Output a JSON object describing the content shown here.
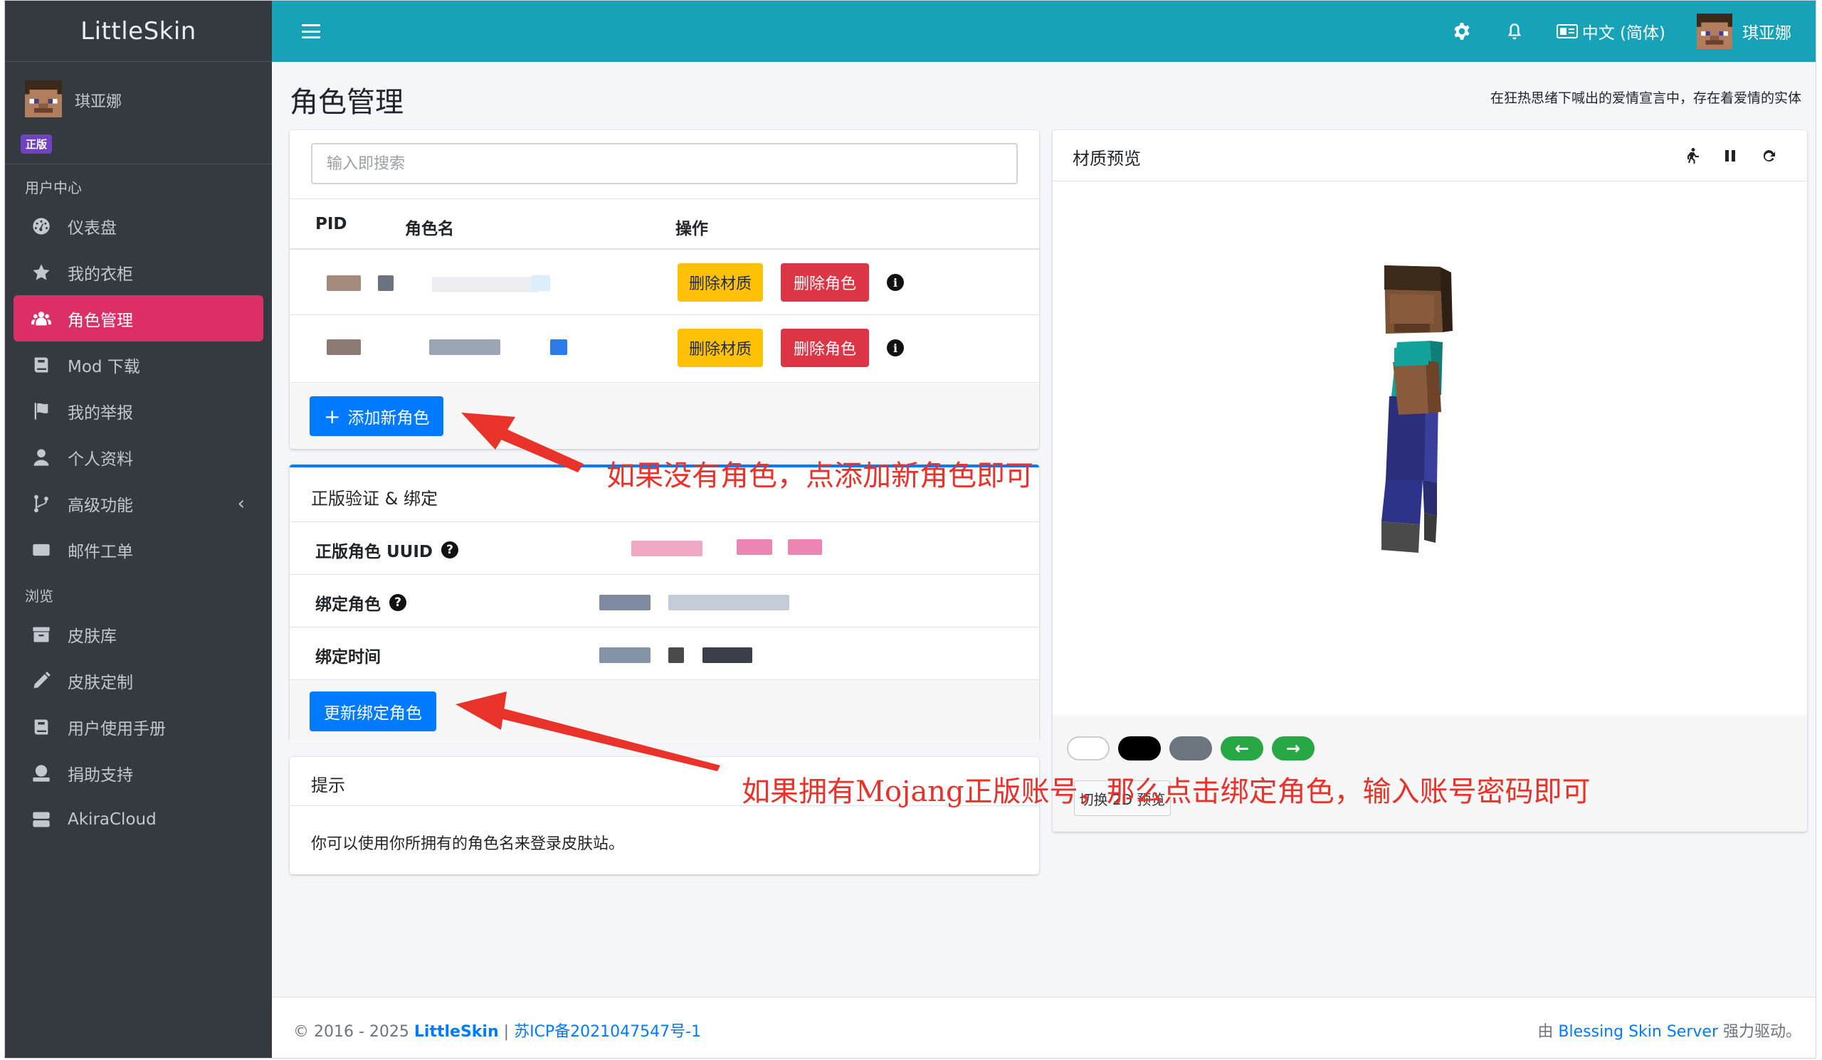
{
  "brand": "LittleSkin",
  "user": {
    "name": "琪亚娜",
    "badge": "正版"
  },
  "topbar": {
    "language": "中文 (简体)",
    "username": "琪亚娜"
  },
  "sidebar": {
    "section_user": "用户中心",
    "section_browse": "浏览",
    "items": [
      {
        "label": "仪表盘",
        "icon": "dashboard-icon"
      },
      {
        "label": "我的衣柜",
        "icon": "star-icon"
      },
      {
        "label": "角色管理",
        "icon": "users-icon",
        "active": true
      },
      {
        "label": "Mod 下载",
        "icon": "book-icon"
      },
      {
        "label": "我的举报",
        "icon": "flag-icon"
      },
      {
        "label": "个人资料",
        "icon": "user-icon"
      },
      {
        "label": "高级功能",
        "icon": "branch-icon"
      },
      {
        "label": "邮件工单",
        "icon": "envelope-icon"
      },
      {
        "label": "皮肤库",
        "icon": "archive-icon"
      },
      {
        "label": "皮肤定制",
        "icon": "pencil-icon"
      },
      {
        "label": "用户使用手册",
        "icon": "book-icon"
      },
      {
        "label": "捐助支持",
        "icon": "donate-icon"
      },
      {
        "label": "AkiraCloud",
        "icon": "server-icon"
      }
    ]
  },
  "page": {
    "title": "角色管理",
    "tagline": "在狂热思绪下喊出的爱情宣言中，存在着爱情的实体"
  },
  "roles": {
    "search_placeholder": "输入即搜索",
    "columns": [
      "PID",
      "角色名",
      "操作"
    ],
    "rows": [
      {
        "delete_texture": "删除材质",
        "delete_role": "删除角色"
      },
      {
        "delete_texture": "删除材质",
        "delete_role": "删除角色"
      }
    ],
    "add_button": "添加新角色"
  },
  "verify": {
    "title": "正版验证 & 绑定",
    "uuid_label": "正版角色 UUID",
    "bound_role_label": "绑定角色",
    "bound_time_label": "绑定时间",
    "update_button": "更新绑定角色"
  },
  "tips": {
    "title": "提示",
    "body": "你可以使用你所拥有的角色名来登录皮肤站。"
  },
  "preview": {
    "title": "材质预览",
    "toggle_button": "切换 2D 预览",
    "backgrounds": [
      "#ffffff",
      "#000000",
      "#6c757d"
    ]
  },
  "footer": {
    "copyright": "© 2016 - 2025",
    "site": "LittleSkin",
    "separator": "|",
    "icp": "苏ICP备2021047547号-1",
    "powered_prefix": "由",
    "powered_link": "Blessing Skin Server",
    "powered_suffix": "强力驱动。"
  },
  "annotations": {
    "add_role_hint": "如果没有角色，点添加新角色即可",
    "bind_hint": "如果拥有Mojang正版账号，那么点击绑定角色，输入账号密码即可"
  }
}
